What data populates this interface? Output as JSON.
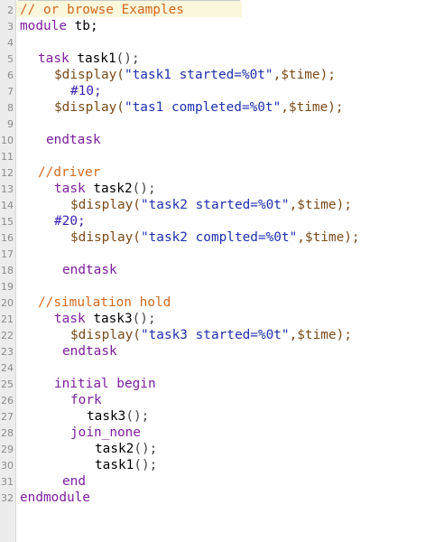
{
  "editor": {
    "colors": {
      "comment": "#d2691e",
      "keyword": "#7f1f9f",
      "plain": "#000000",
      "system": "#7a4a18",
      "string": "#1f2fb0",
      "number": "#3b1fb0",
      "gutter_bg": "#ececec",
      "highlight_bg": "#fbf7dc"
    },
    "lines": [
      {
        "number": "2",
        "tokens": [
          {
            "c": "cmt",
            "t": "// or browse Examples"
          }
        ]
      },
      {
        "number": "3",
        "tokens": [
          {
            "c": "kw",
            "t": "module"
          },
          {
            "c": "tx",
            "t": " tb;"
          }
        ]
      },
      {
        "number": "4",
        "tokens": []
      },
      {
        "number": "5",
        "tokens": [
          {
            "c": "kw",
            "t": "task"
          },
          {
            "c": "tx",
            "t": " task1"
          },
          {
            "c": "pun",
            "t": "();"
          }
        ]
      },
      {
        "number": "6",
        "tokens": [
          {
            "c": "sys",
            "t": "$display("
          },
          {
            "c": "str",
            "t": "\"task1 started=%0t\""
          },
          {
            "c": "sys",
            "t": ",$time);"
          }
        ]
      },
      {
        "number": "7",
        "tokens": [
          {
            "c": "num",
            "t": "#10;"
          }
        ]
      },
      {
        "number": "8",
        "tokens": [
          {
            "c": "sys",
            "t": "$display("
          },
          {
            "c": "str",
            "t": "\"tas1 completed=%0t\""
          },
          {
            "c": "sys",
            "t": ",$time);"
          }
        ]
      },
      {
        "number": "9",
        "tokens": []
      },
      {
        "number": "10",
        "tokens": [
          {
            "c": "kw",
            "t": "endtask"
          }
        ]
      },
      {
        "number": "11",
        "tokens": []
      },
      {
        "number": "12",
        "tokens": [
          {
            "c": "cmt",
            "t": "//driver"
          }
        ]
      },
      {
        "number": "13",
        "tokens": [
          {
            "c": "kw",
            "t": "task"
          },
          {
            "c": "tx",
            "t": " task2"
          },
          {
            "c": "pun",
            "t": "();"
          }
        ]
      },
      {
        "number": "14",
        "tokens": [
          {
            "c": "sys",
            "t": "$display("
          },
          {
            "c": "str",
            "t": "\"task2 started=%0t\""
          },
          {
            "c": "sys",
            "t": ",$time);"
          }
        ]
      },
      {
        "number": "15",
        "tokens": [
          {
            "c": "num",
            "t": "#20;"
          }
        ]
      },
      {
        "number": "16",
        "tokens": [
          {
            "c": "sys",
            "t": "$display("
          },
          {
            "c": "str",
            "t": "\"task2 complted=%0t\""
          },
          {
            "c": "sys",
            "t": ",$time);"
          }
        ]
      },
      {
        "number": "17",
        "tokens": []
      },
      {
        "number": "18",
        "tokens": [
          {
            "c": "kw",
            "t": "endtask"
          }
        ]
      },
      {
        "number": "19",
        "tokens": []
      },
      {
        "number": "20",
        "tokens": [
          {
            "c": "cmt",
            "t": "//simulation hold"
          }
        ]
      },
      {
        "number": "21",
        "tokens": [
          {
            "c": "kw",
            "t": "task"
          },
          {
            "c": "tx",
            "t": " task3"
          },
          {
            "c": "pun",
            "t": "();"
          }
        ]
      },
      {
        "number": "22",
        "tokens": [
          {
            "c": "sys",
            "t": "$display("
          },
          {
            "c": "str",
            "t": "\"task3 started=%0t\""
          },
          {
            "c": "sys",
            "t": ",$time);"
          }
        ]
      },
      {
        "number": "23",
        "tokens": [
          {
            "c": "kw",
            "t": "endtask"
          }
        ]
      },
      {
        "number": "24",
        "tokens": []
      },
      {
        "number": "25",
        "tokens": [
          {
            "c": "kw",
            "t": "initial begin"
          }
        ]
      },
      {
        "number": "26",
        "tokens": [
          {
            "c": "kw",
            "t": "fork"
          }
        ]
      },
      {
        "number": "27",
        "tokens": [
          {
            "c": "tx",
            "t": "task3"
          },
          {
            "c": "pun",
            "t": "();"
          }
        ]
      },
      {
        "number": "28",
        "tokens": [
          {
            "c": "kw",
            "t": "join_none"
          }
        ]
      },
      {
        "number": "29",
        "tokens": [
          {
            "c": "tx",
            "t": "task2"
          },
          {
            "c": "pun",
            "t": "();"
          }
        ]
      },
      {
        "number": "30",
        "tokens": [
          {
            "c": "tx",
            "t": "task1"
          },
          {
            "c": "pun",
            "t": "();"
          }
        ]
      },
      {
        "number": "31",
        "tokens": [
          {
            "c": "kw",
            "t": "end"
          }
        ]
      },
      {
        "number": "32",
        "tokens": [
          {
            "c": "kw",
            "t": "endmodule"
          }
        ]
      }
    ]
  }
}
